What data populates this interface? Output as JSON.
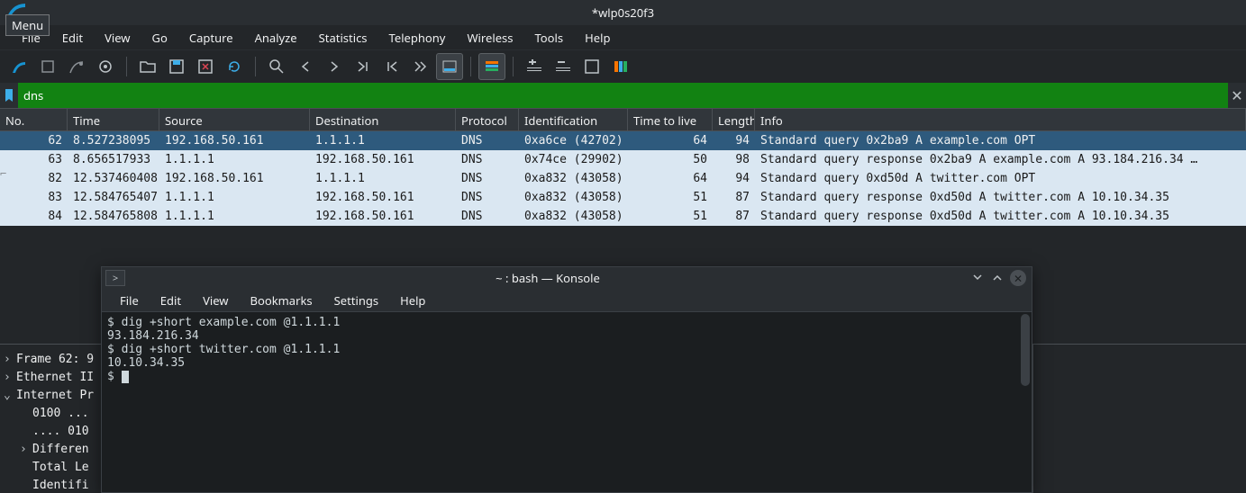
{
  "window": {
    "title": "*wlp0s20f3",
    "menu_badge": "Menu"
  },
  "menubar": [
    "File",
    "Edit",
    "View",
    "Go",
    "Capture",
    "Analyze",
    "Statistics",
    "Telephony",
    "Wireless",
    "Tools",
    "Help"
  ],
  "filter": {
    "value": "dns"
  },
  "columns": [
    "No.",
    "Time",
    "Source",
    "Destination",
    "Protocol",
    "Identification",
    "Time to live",
    "Length",
    "Info"
  ],
  "packets": [
    {
      "no": "62",
      "time": "8.527238095",
      "src": "192.168.50.161",
      "dst": "1.1.1.1",
      "proto": "DNS",
      "id": "0xa6ce (42702)",
      "ttl": "64",
      "len": "94",
      "info": "Standard query 0x2ba9 A example.com OPT",
      "sel": true
    },
    {
      "no": "63",
      "time": "8.656517933",
      "src": "1.1.1.1",
      "dst": "192.168.50.161",
      "proto": "DNS",
      "id": "0x74ce (29902)",
      "ttl": "50",
      "len": "98",
      "info": "Standard query response 0x2ba9 A example.com A 93.184.216.34 …",
      "sel": false
    },
    {
      "no": "82",
      "time": "12.537460408",
      "src": "192.168.50.161",
      "dst": "1.1.1.1",
      "proto": "DNS",
      "id": "0xa832 (43058)",
      "ttl": "64",
      "len": "94",
      "info": "Standard query 0xd50d A twitter.com OPT",
      "sel": false
    },
    {
      "no": "83",
      "time": "12.584765407",
      "src": "1.1.1.1",
      "dst": "192.168.50.161",
      "proto": "DNS",
      "id": "0xa832 (43058)",
      "ttl": "51",
      "len": "87",
      "info": "Standard query response 0xd50d A twitter.com A 10.10.34.35",
      "sel": false
    },
    {
      "no": "84",
      "time": "12.584765808",
      "src": "1.1.1.1",
      "dst": "192.168.50.161",
      "proto": "DNS",
      "id": "0xa832 (43058)",
      "ttl": "51",
      "len": "87",
      "info": "Standard query response 0xd50d A twitter.com A 10.10.34.35",
      "sel": false
    }
  ],
  "tree": [
    {
      "exp": ">",
      "indent": 0,
      "text": "Frame 62: 9"
    },
    {
      "exp": ">",
      "indent": 0,
      "text": "Ethernet II"
    },
    {
      "exp": "v",
      "indent": 0,
      "text": "Internet Pr"
    },
    {
      "exp": "",
      "indent": 1,
      "text": "0100 ..."
    },
    {
      "exp": "",
      "indent": 1,
      "text": ".... 010"
    },
    {
      "exp": ">",
      "indent": 1,
      "text": "Differen"
    },
    {
      "exp": "",
      "indent": 1,
      "text": "Total Le"
    },
    {
      "exp": "",
      "indent": 1,
      "text": "Identifi"
    }
  ],
  "konsole": {
    "title": "~ : bash — Konsole",
    "menu": [
      "File",
      "Edit",
      "View",
      "Bookmarks",
      "Settings",
      "Help"
    ],
    "lines": [
      "$ dig +short example.com @1.1.1.1",
      "93.184.216.34",
      "$ dig +short twitter.com @1.1.1.1",
      "10.10.34.35",
      "$ "
    ]
  }
}
